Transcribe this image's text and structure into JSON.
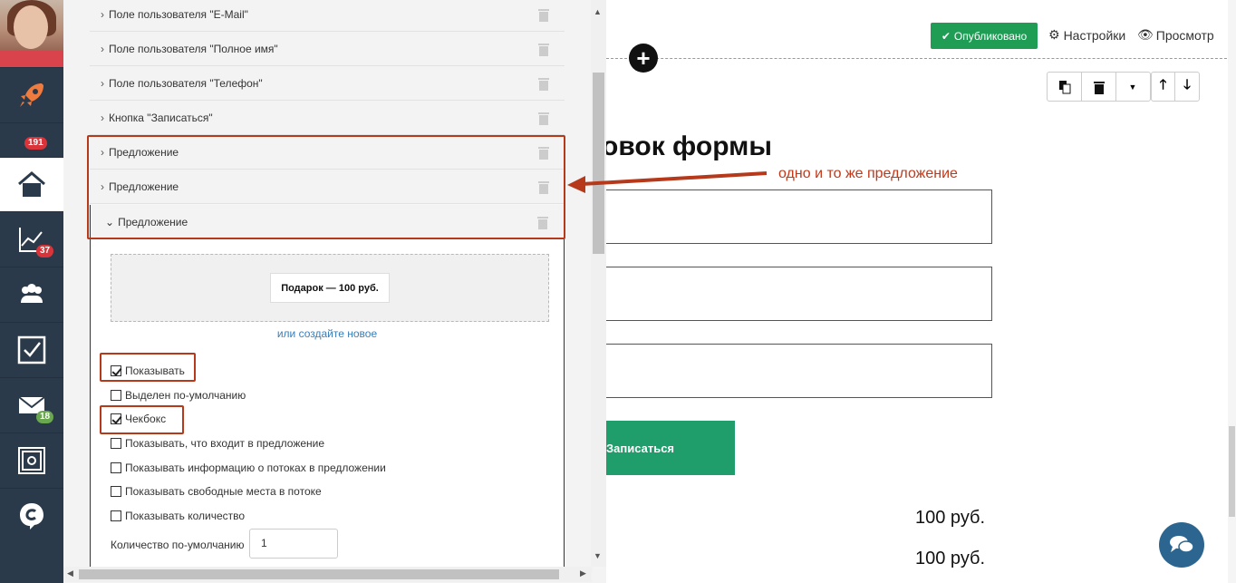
{
  "nav": {
    "badges": {
      "notifications": "191",
      "stats": "37",
      "messages": "18"
    },
    "icons": [
      "rocket-icon",
      "home-icon",
      "chart-icon",
      "users-icon",
      "checkbox-icon",
      "mail-icon",
      "safe-icon",
      "chat-c-icon"
    ]
  },
  "sidebar": {
    "rows": [
      "Поле пользователя \"E-Mail\"",
      "Поле пользователя \"Полное имя\"",
      "Поле пользователя \"Телефон\"",
      "Кнопка \"Записаться\"",
      "Предложение",
      "Предложение"
    ],
    "expanded_title": "Предложение",
    "offer_chip": "Подарок — 100 руб.",
    "create_link": "или создайте новое",
    "checkboxes": [
      {
        "label": "Показывать",
        "checked": true
      },
      {
        "label": "Выделен по-умолчанию",
        "checked": false
      },
      {
        "label": "Чекбокс",
        "checked": true
      },
      {
        "label": "Показывать, что входит в предложение",
        "checked": false
      },
      {
        "label": "Показывать информацию о потоках в предложении",
        "checked": false
      },
      {
        "label": "Показывать свободные места в потоке",
        "checked": false
      },
      {
        "label": "Показывать количество",
        "checked": false
      }
    ],
    "qty_label": "Количество по-умолчанию",
    "qty_value": "1"
  },
  "main": {
    "published_label": "Опубликовано",
    "settings_label": "Настройки",
    "preview_label": "Просмотр",
    "form_title": "овок формы",
    "annotation": "одно и то же предложение",
    "submit_label": "Записаться",
    "prices": [
      "100 руб.",
      "100 руб."
    ]
  },
  "colors": {
    "accent_green": "#1f9d55",
    "annotation_red": "#b5391a",
    "nav_bg": "#2b3a4a"
  }
}
